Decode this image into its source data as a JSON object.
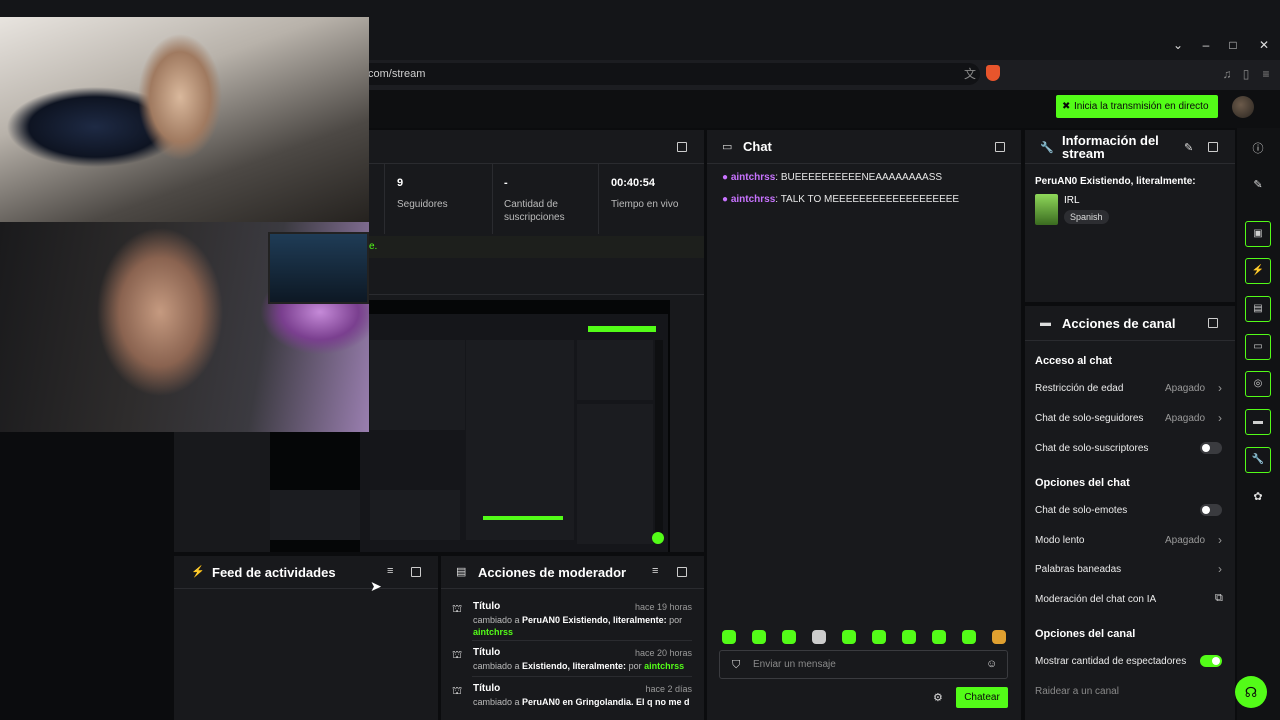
{
  "browser": {
    "url": "com/stream"
  },
  "header": {
    "go_live_label": "Inicia la transmisión en directo"
  },
  "stats": [
    {
      "value": "9",
      "label": "Seguidores"
    },
    {
      "value": "-",
      "label": "Cantidad de suscripciones"
    },
    {
      "value": "00:40:54",
      "label": "Tiempo en vivo"
    }
  ],
  "status_fragment": "e.",
  "chat": {
    "title": "Chat",
    "messages": [
      {
        "user": "aintchrss",
        "text": "BUEEEEEEEEEENEAAAAAAAASS"
      },
      {
        "user": "aintchrss",
        "text": "TALK TO MEEEEEEEEEEEEEEEEEEE"
      }
    ],
    "input_placeholder": "Enviar un mensaje",
    "send_label": "Chatear"
  },
  "stream_info": {
    "title_line1": "Información del",
    "title_line2": "stream",
    "stream_title": "PeruAN0 Existiendo, literalmente:",
    "category": "IRL",
    "language": "Spanish"
  },
  "channel_actions": {
    "title": "Acciones de canal",
    "sections": {
      "chat_access": "Acceso al chat",
      "chat_options": "Opciones del chat",
      "channel_options": "Opciones del canal"
    },
    "age_restriction": {
      "label": "Restricción de edad",
      "value": "Apagado"
    },
    "followers_only": {
      "label": "Chat de solo-seguidores",
      "value": "Apagado"
    },
    "subscribers_only": {
      "label": "Chat de solo-suscriptores"
    },
    "emotes_only": {
      "label": "Chat de solo-emotes"
    },
    "slow_mode": {
      "label": "Modo lento",
      "value": "Apagado"
    },
    "banned_words": {
      "label": "Palabras baneadas"
    },
    "ai_moderation": {
      "label": "Moderación del chat con IA"
    },
    "show_viewers": {
      "label": "Mostrar cantidad de espectadores"
    },
    "raid": {
      "label": "Raidear a un canal"
    }
  },
  "activity_feed": {
    "title": "Feed de actividades"
  },
  "moderator_actions": {
    "title": "Acciones de moderador",
    "items": [
      {
        "title": "Título",
        "time": "hace 19 horas",
        "prefix": "cambiado a ",
        "value": "PeruAN0 Existiendo, literalmente:",
        "by": " por",
        "user": "aintchrss"
      },
      {
        "title": "Título",
        "time": "hace 20 horas",
        "prefix": "cambiado a ",
        "value": "Existiendo, literalmente:",
        "by": " por ",
        "user": "aintchrss"
      },
      {
        "title": "Título",
        "time": "hace 2 días",
        "prefix": "cambiado a ",
        "value": "PeruAN0 en Gringolandia. El q no me d",
        "by": "",
        "user": ""
      }
    ]
  }
}
